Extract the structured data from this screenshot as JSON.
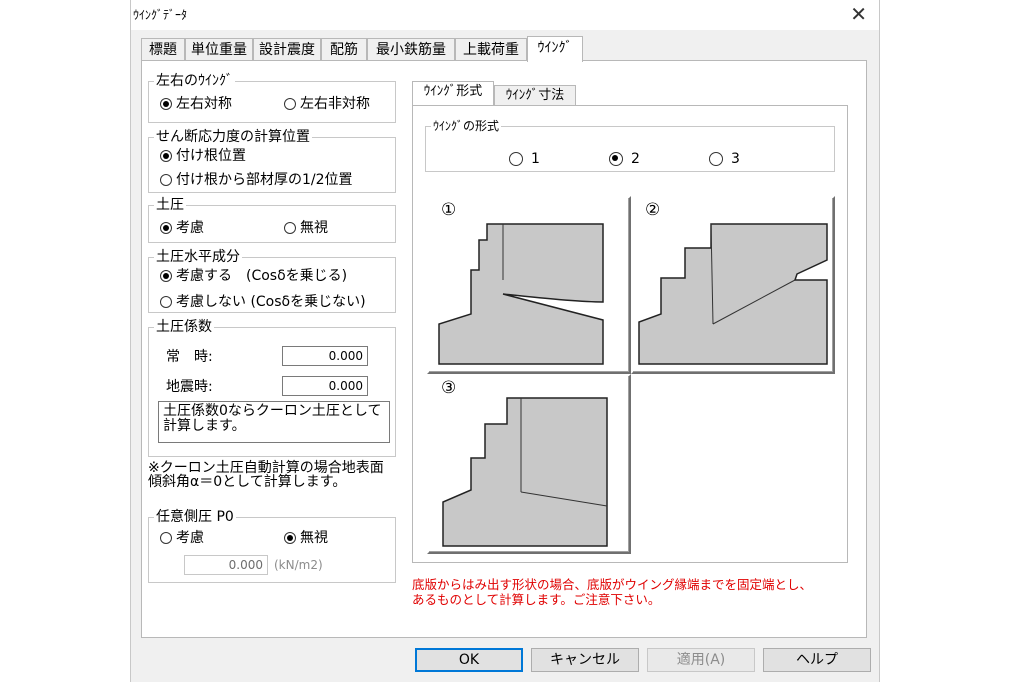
{
  "window": {
    "title": "ｳｲﾝｸﾞﾃﾞｰﾀ",
    "close": "✕"
  },
  "tabs": [
    "標題",
    "単位重量",
    "設計震度",
    "配筋",
    "最小鉄筋量",
    "上載荷重",
    "ｳｲﾝｸﾞ"
  ],
  "left": {
    "lr": {
      "title": "左右のｳｲﾝｸﾞ",
      "opt1": "左右対称",
      "opt2": "左右非対称"
    },
    "shear": {
      "title": "せん断応力度の計算位置",
      "opt1": "付け根位置",
      "opt2": "付け根から部材厚の1/2位置"
    },
    "earth": {
      "title": "土圧",
      "opt1": "考慮",
      "opt2": "無視"
    },
    "horiz": {
      "title": "土圧水平成分",
      "opt1": "考慮する　(Cosδを乗じる)",
      "opt2": "考慮しない (Cosδを乗じない)"
    },
    "coef": {
      "title": "土圧係数",
      "normal_label": "常　時:",
      "normal_value": "0.000",
      "quake_label": "地震時:",
      "quake_value": "0.000",
      "note1": "土圧係数0ならクーロン土圧として",
      "note2": "計算します。"
    },
    "remark1": "※クーロン土圧自動計算の場合地表面",
    "remark2": "傾斜角α＝0として計算します。",
    "p0": {
      "title": "任意側圧 P0",
      "opt1": "考慮",
      "opt2": "無視",
      "value": "0.000",
      "unit": "(kN/m2)"
    }
  },
  "right": {
    "subtabs": [
      "ｳｲﾝｸﾞ形式",
      "ｳｲﾝｸﾞ寸法"
    ],
    "form": {
      "title": "ｳｲﾝｸﾞの形式",
      "opt1": "1",
      "opt2": "2",
      "opt3": "3",
      "selected": "2"
    },
    "figs": [
      "①",
      "②",
      "③"
    ],
    "warning1": "底版からはみ出す形状の場合、底版がウイング縁端までを固定端とし、",
    "warning2": "あるものとして計算します。ご注意下さい。"
  },
  "buttons": {
    "ok": "OK",
    "cancel": "キャンセル",
    "apply": "適用(A)",
    "help": "ヘルプ"
  },
  "colors": {
    "shape_fill": "#c8c8c8",
    "warning": "#e00000",
    "accent": "#0078d7"
  }
}
